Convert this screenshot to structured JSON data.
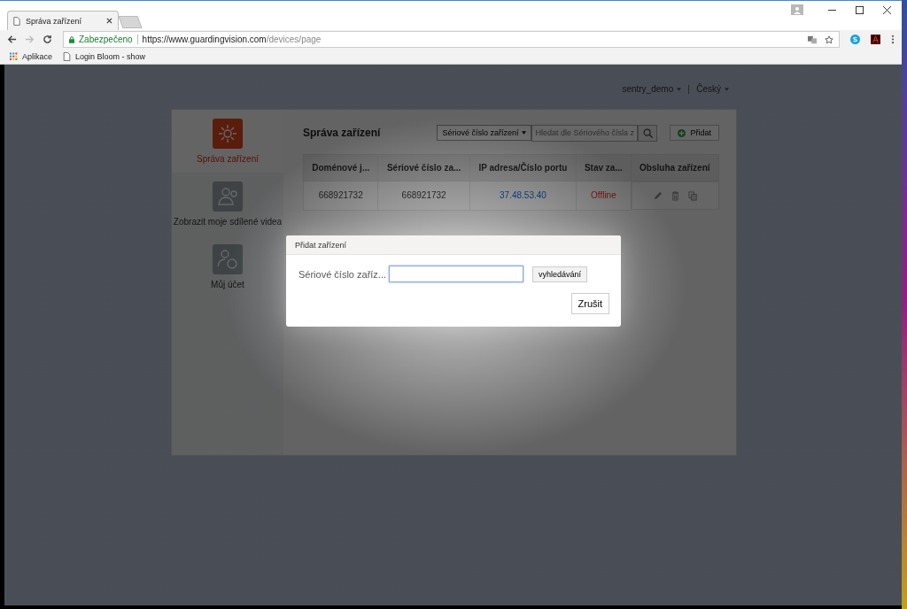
{
  "browser": {
    "tabs": [
      {
        "title": "Správa zařízení",
        "selected": true
      }
    ],
    "address": {
      "security": "Zabezpečeno",
      "origin": "https://www.guardingvision.com",
      "path": "/devices/page"
    },
    "bookmarks": [
      "Aplikace",
      "Login Bloom - show"
    ]
  },
  "header": {
    "user": "sentry_demo",
    "language": "Český"
  },
  "sidebar": {
    "items": [
      {
        "label": "Správa zařízení",
        "kind": "gear",
        "selected": true
      },
      {
        "label": "Zobrazit moje sdílené videa",
        "kind": "share",
        "selected": false
      },
      {
        "label": "Můj účet",
        "kind": "account",
        "selected": false
      }
    ]
  },
  "main": {
    "title": "Správa zařízení",
    "search": {
      "type": "Sériové číslo zařízení",
      "placeholder": "Hledat dle Sériového čísla z"
    },
    "add_button": "Přidat",
    "table": {
      "columns": [
        "Doménové j...",
        "Sériové číslo za...",
        "IP adresa/Číslo portu",
        "Stav za...",
        "Obsluha zařízení"
      ],
      "rows": [
        {
          "domain": "668921732",
          "serial": "668921732",
          "ip": "37.48.53.40",
          "status": "Offline",
          "online": false
        }
      ]
    }
  },
  "dialog": {
    "title": "Přidat zařízení",
    "label": "Sériové číslo zaříz...",
    "search_button": "vyhledávání",
    "cancel_button": "Zrušit"
  }
}
